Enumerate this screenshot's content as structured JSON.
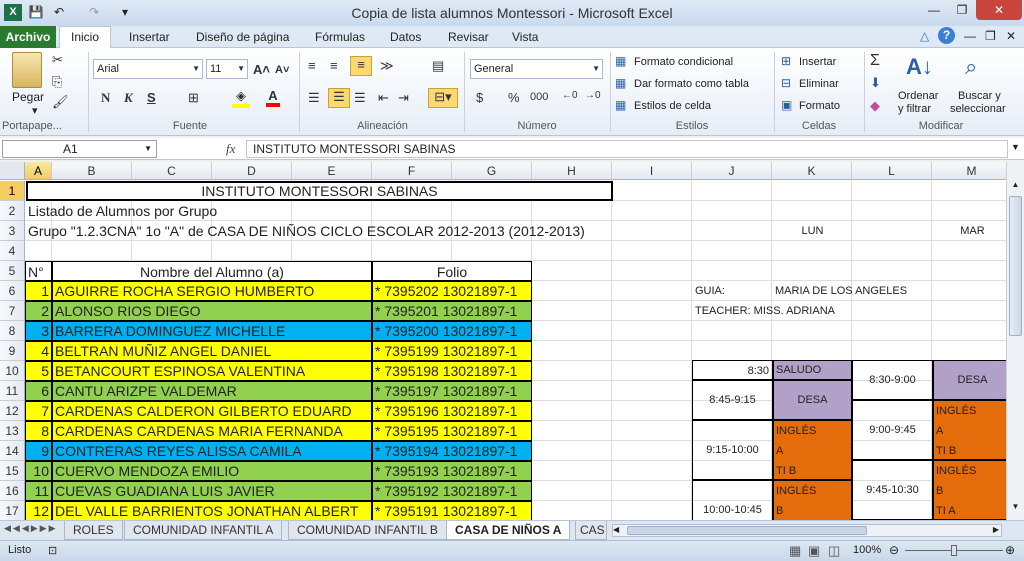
{
  "window": {
    "title": "Copia de lista alumnos Montessori  -  Microsoft Excel",
    "qa_undo": "↶",
    "qa_redo": "↷",
    "qa_more": "▾",
    "min": "—",
    "restore": "❐",
    "close": "✕"
  },
  "ribbon_tabs": [
    "Archivo",
    "Inicio",
    "Insertar",
    "Diseño de página",
    "Fórmulas",
    "Datos",
    "Revisar",
    "Vista"
  ],
  "ribbon": {
    "pegar": "Pegar",
    "font_name": "Arial",
    "font_size": "11",
    "bold": "N",
    "italic": "K",
    "underline": "S",
    "number_format": "General",
    "currency": "$",
    "percent": "%",
    "thousands": "000",
    "cond_format": "Formato condicional",
    "table_format": "Dar formato como tabla",
    "cell_styles": "Estilos de celda",
    "insert": "Insertar",
    "delete": "Eliminar",
    "format": "Formato",
    "sigma": "Σ",
    "sort_filter": [
      "Ordenar",
      "y filtrar"
    ],
    "find_select": [
      "Buscar y",
      "seleccionar"
    ],
    "groups": [
      "Portapape...",
      "Fuente",
      "Alineación",
      "Número",
      "Estilos",
      "Celdas",
      "Modificar"
    ]
  },
  "formula_bar": {
    "name_box": "A1",
    "fx": "fx",
    "content": "INSTITUTO MONTESSORI SABINAS"
  },
  "columns": [
    "A",
    "B",
    "C",
    "D",
    "E",
    "F",
    "G",
    "H",
    "I",
    "J",
    "K",
    "L",
    "M"
  ],
  "rows": [
    "1",
    "2",
    "3",
    "4",
    "5",
    "6",
    "7",
    "8",
    "9",
    "10",
    "11",
    "12",
    "13",
    "14",
    "15",
    "16",
    "17"
  ],
  "sheet": {
    "title": "INSTITUTO MONTESSORI SABINAS",
    "subtitle": "Listado de Alumnos por Grupo",
    "group": "Grupo \"1.2.3CNA\" 1o \"A\" de  CASA DE NIÑOS CICLO ESCOLAR 2012-2013 (2012-2013)",
    "hdr_num": "N°",
    "hdr_name": "Nombre del Alumno (a)",
    "hdr_folio": "Folio",
    "students": [
      {
        "n": "1",
        "name": "AGUIRRE ROCHA SERGIO HUMBERTO",
        "folio": "* 7395202 13021897-1",
        "color": "#ffff00"
      },
      {
        "n": "2",
        "name": "ALONSO RIOS DIEGO",
        "folio": "* 7395201 13021897-1",
        "color": "#92d050"
      },
      {
        "n": "3",
        "name": "BARRERA DOMINGUEZ MICHELLE",
        "folio": "* 7395200 13021897-1",
        "color": "#00b0f0"
      },
      {
        "n": "4",
        "name": "BELTRAN MUÑIZ ANGEL DANIEL",
        "folio": "* 7395199 13021897-1",
        "color": "#ffff00"
      },
      {
        "n": "5",
        "name": "BETANCOURT ESPINOSA VALENTINA",
        "folio": "* 7395198 13021897-1",
        "color": "#ffff00"
      },
      {
        "n": "6",
        "name": "CANTU ARIZPE VALDEMAR",
        "folio": "* 7395197 13021897-1",
        "color": "#92d050"
      },
      {
        "n": "7",
        "name": "CARDENAS  CALDERON GILBERTO EDUARD",
        "folio": "* 7395196 13021897-1",
        "color": "#ffff00"
      },
      {
        "n": "8",
        "name": "CARDENAS CARDENAS MARIA FERNANDA",
        "folio": "* 7395195 13021897-1",
        "color": "#ffff00"
      },
      {
        "n": "9",
        "name": "CONTRERAS REYES ALISSA CAMILA",
        "folio": "* 7395194 13021897-1",
        "color": "#00b0f0"
      },
      {
        "n": "10",
        "name": "CUERVO MENDOZA EMILIO",
        "folio": "* 7395193 13021897-1",
        "color": "#92d050"
      },
      {
        "n": "11",
        "name": "CUEVAS GUADIANA LUIS JAVIER",
        "folio": "* 7395192 13021897-1",
        "color": "#92d050"
      },
      {
        "n": "12",
        "name": "DEL VALLE BARRIENTOS JONATHAN ALBERT",
        "folio": "* 7395191 13021897-1",
        "color": "#ffff00"
      }
    ],
    "lun": "LUN",
    "mar": "MAR",
    "guia_label": "GUIA:",
    "guia_name": "MARIA DE LOS ANGELES",
    "teacher": "TEACHER: MISS. ADRIANA",
    "sched": {
      "t830": "8:30",
      "saludo": "SALUDO",
      "t830_900": "8:30-9:00",
      "desa_m": "DESA",
      "t845_915": "8:45-9:15",
      "desa_l": "DESA",
      "t900_945": "9:00-9:45",
      "ingles1": "INGLÉS",
      "a1": "A",
      "tib1": "TI B",
      "t915_1000": "9:15-10:00",
      "ingles2": "INGLÉS",
      "a2": "A",
      "tib2": "TI B",
      "t945_1030": "9:45-10:30",
      "ingles3": "INGLÉS",
      "b3": "B",
      "t1000_1045": "10:00-10:45",
      "ingles4": "INGLÉS",
      "b4": "B",
      "tia4": "TI A"
    }
  },
  "sheet_tabs": [
    "ROLES",
    "COMUNIDAD INFANTIL A",
    "COMUNIDAD INFANTIL B",
    "CASA DE NIÑOS A",
    "CAS"
  ],
  "status": {
    "ready": "Listo",
    "zoom": "100%"
  },
  "colors": {
    "orange": "#e46c0a",
    "lavender": "#b1a0c7"
  }
}
